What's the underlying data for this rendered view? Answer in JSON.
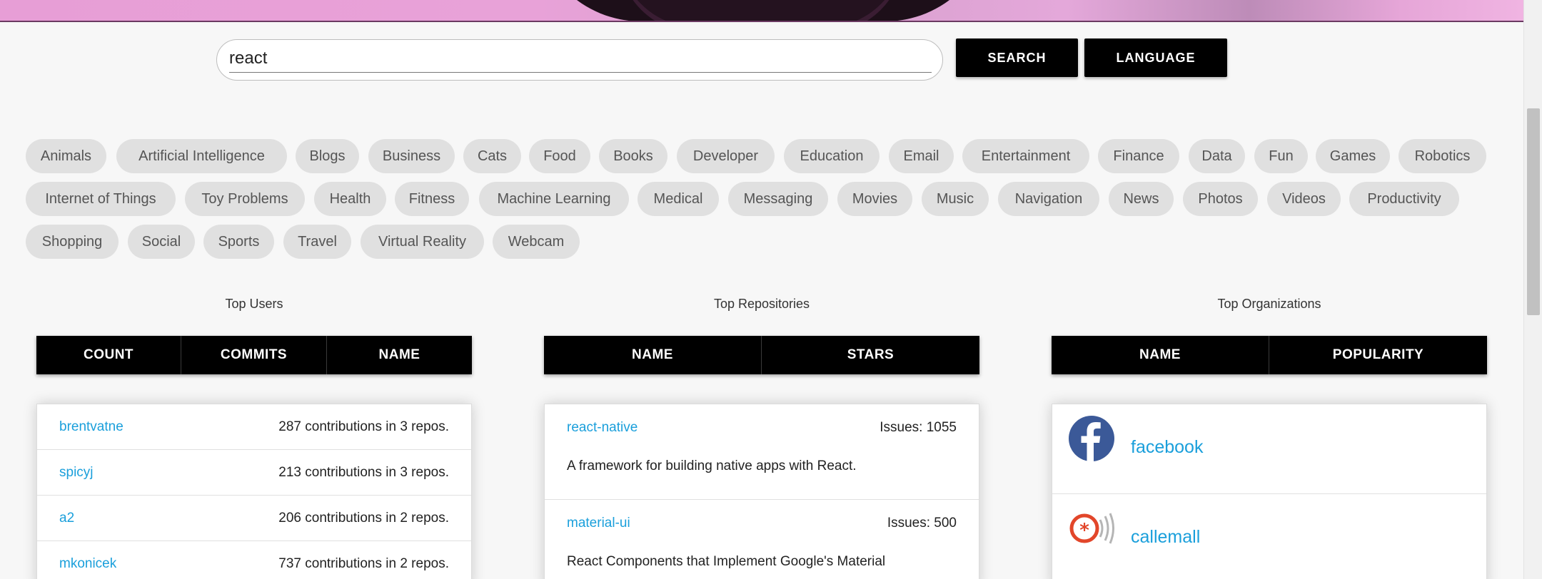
{
  "search": {
    "query": "react",
    "search_label": "SEARCH",
    "language_label": "LANGUAGE"
  },
  "topics": [
    "Animals",
    "Artificial Intelligence",
    "Blogs",
    "Business",
    "Cats",
    "Food",
    "Books",
    "Developer",
    "Education",
    "Email",
    "Entertainment",
    "Finance",
    "Data",
    "Fun",
    "Games",
    "Robotics",
    "Internet of Things",
    "Toy Problems",
    "Health",
    "Fitness",
    "Machine Learning",
    "Medical",
    "Messaging",
    "Movies",
    "Music",
    "Navigation",
    "News",
    "Photos",
    "Videos",
    "Productivity",
    "Shopping",
    "Social",
    "Sports",
    "Travel",
    "Virtual Reality",
    "Webcam"
  ],
  "top_users": {
    "title": "Top Users",
    "columns": [
      "COUNT",
      "COMMITS",
      "NAME"
    ],
    "rows": [
      {
        "name": "brentvatne",
        "summary": "287 contributions in 3 repos."
      },
      {
        "name": "spicyj",
        "summary": "213 contributions in 3 repos."
      },
      {
        "name": "a2",
        "summary": "206 contributions in 2 repos."
      },
      {
        "name": "mkonicek",
        "summary": "737 contributions in 2 repos."
      }
    ]
  },
  "top_repositories": {
    "title": "Top Repositories",
    "columns": [
      "NAME",
      "STARS"
    ],
    "rows": [
      {
        "name": "react-native",
        "issues": "Issues: 1055",
        "description": "A framework for building native apps with React."
      },
      {
        "name": "material-ui",
        "issues": "Issues: 500",
        "description": "React Components that Implement Google's Material"
      }
    ]
  },
  "top_organizations": {
    "title": "Top Organizations",
    "columns": [
      "NAME",
      "POPULARITY"
    ],
    "rows": [
      {
        "name": "facebook",
        "icon": "facebook-logo-icon"
      },
      {
        "name": "callemall",
        "icon": "callemall-logo-icon"
      }
    ]
  },
  "colors": {
    "link": "#1a9fdb",
    "button": "#000000",
    "chip": "#e0e0e0",
    "facebook": "#3b5998",
    "callemall": "#e2462a"
  }
}
